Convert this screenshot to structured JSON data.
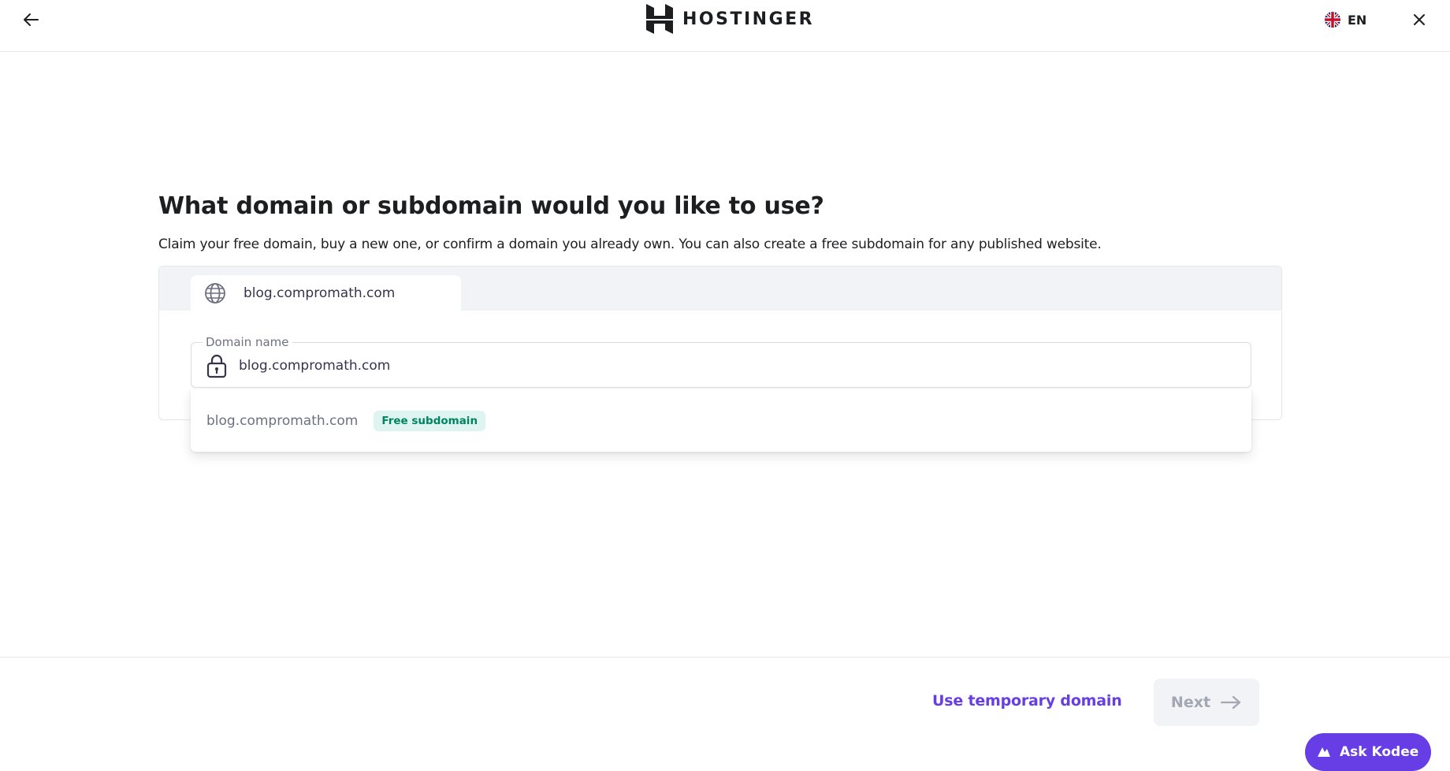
{
  "header": {
    "back_icon": "arrow-left-icon",
    "logo_text": "HOSTINGER",
    "language": {
      "code": "EN",
      "flag_icon": "uk-flag-icon"
    },
    "close_icon": "close-icon"
  },
  "main": {
    "title": "What domain or subdomain would you like to use?",
    "subtitle": "Claim your free domain, buy a new one, or confirm a domain you already own. You can also create a free subdomain for any published website.",
    "tab": {
      "label": "blog.compromath.com",
      "icon": "globe-icon"
    },
    "domain_field": {
      "label": "Domain name",
      "value": "blog.compromath.com",
      "icon": "lock-icon"
    },
    "suggestions": [
      {
        "label": "blog.compromath.com",
        "badge": "Free subdomain"
      }
    ]
  },
  "footer": {
    "temporary_domain_label": "Use temporary domain",
    "next_label": "Next",
    "next_icon": "arrow-right-icon",
    "next_disabled": true,
    "assistant_label": "Ask Kodee"
  },
  "colors": {
    "primary": "#673de6",
    "text": "#1d1e20",
    "muted": "#6d7081",
    "badge_bg": "#def4f0",
    "badge_text": "#008361",
    "disabled_bg": "#f2f3f6",
    "disabled_text": "#a3a6b3"
  }
}
